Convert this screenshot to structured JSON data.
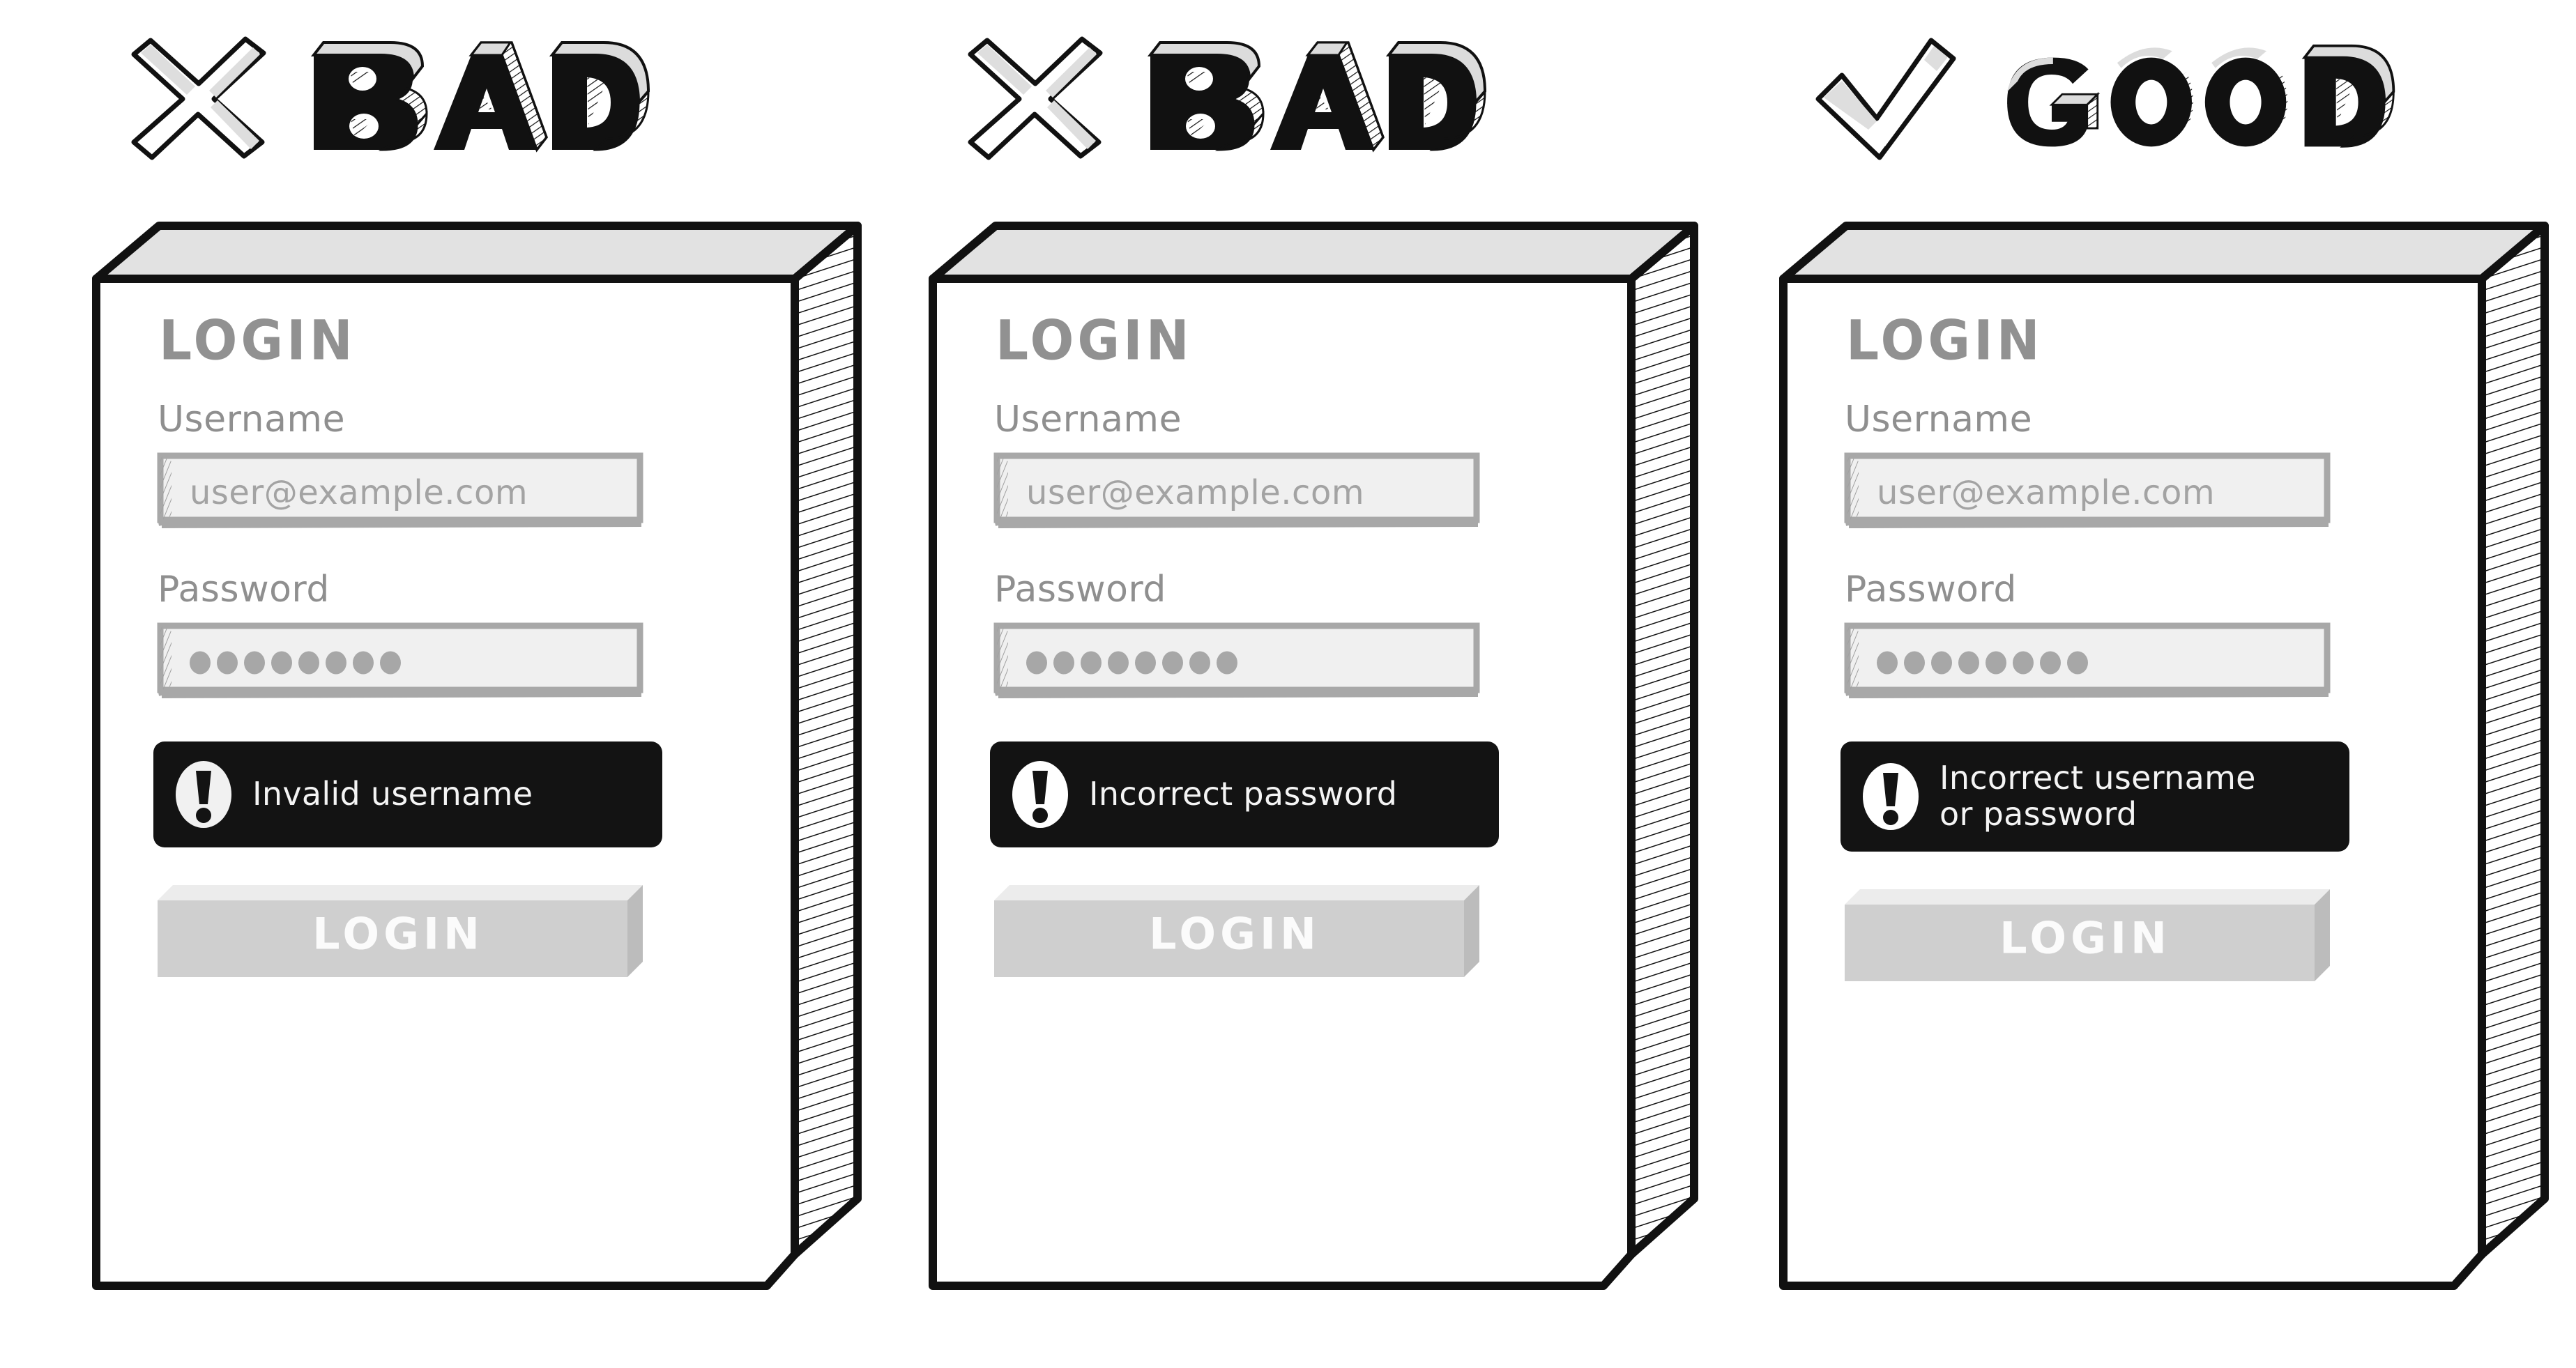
{
  "page": {
    "title": "Login error message: bad vs good examples",
    "background": "#ffffff"
  },
  "colors": {
    "ink": "#111111",
    "card_face": "#ffffff",
    "card_top_bevel": "#e2e2e2",
    "heading_gray": "#919191",
    "label_gray": "#8f8f8f",
    "placeholder_gray": "#a3a3a3",
    "dot_gray": "#a7a7a7",
    "input_fill": "#f0f0f0",
    "input_border": "#a8a8a8",
    "banner_black": "#131313",
    "banner_text": "#f4f4f4",
    "button_face": "#cfcfcf",
    "button_top": "#ececec",
    "button_side": "#bcbcbc",
    "button_label": "#fbfbfb"
  },
  "columns": [
    {
      "verdict": {
        "mark": "cross-mark-icon",
        "label": "BAD"
      },
      "card": {
        "heading": "LOGIN",
        "fields": [
          {
            "label": "Username",
            "type": "text",
            "value": "",
            "placeholder": "user@example.com"
          },
          {
            "label": "Password",
            "type": "password",
            "masked_char_count": 8,
            "placeholder": ""
          }
        ],
        "error": {
          "icon": "exclamation-circle-icon",
          "lines": [
            "Invalid username"
          ]
        },
        "submit_label": "LOGIN"
      }
    },
    {
      "verdict": {
        "mark": "cross-mark-icon",
        "label": "BAD"
      },
      "card": {
        "heading": "LOGIN",
        "fields": [
          {
            "label": "Username",
            "type": "text",
            "value": "",
            "placeholder": "user@example.com"
          },
          {
            "label": "Password",
            "type": "password",
            "masked_char_count": 8,
            "placeholder": ""
          }
        ],
        "error": {
          "icon": "exclamation-circle-icon",
          "lines": [
            "Incorrect password"
          ]
        },
        "submit_label": "LOGIN"
      }
    },
    {
      "verdict": {
        "mark": "check-mark-icon",
        "label": "GOOD"
      },
      "card": {
        "heading": "LOGIN",
        "fields": [
          {
            "label": "Username",
            "type": "text",
            "value": "",
            "placeholder": "user@example.com"
          },
          {
            "label": "Password",
            "type": "password",
            "masked_char_count": 8,
            "placeholder": ""
          }
        ],
        "error": {
          "icon": "exclamation-circle-icon",
          "lines": [
            "Incorrect username",
            "or password"
          ]
        },
        "submit_label": "LOGIN"
      }
    }
  ]
}
